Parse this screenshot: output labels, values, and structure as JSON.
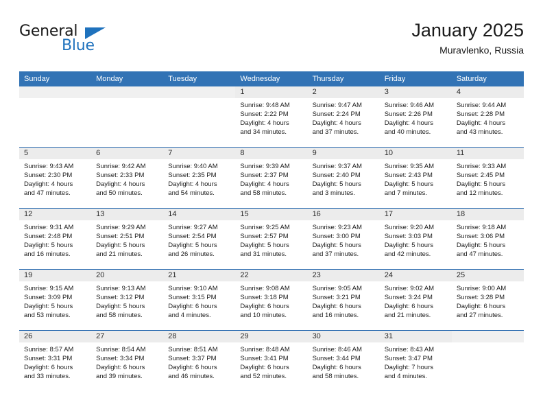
{
  "brand": {
    "name_top": "General",
    "name_bottom": "Blue",
    "triangle_icon": "triangle-icon",
    "color_blue": "#1f72bd",
    "color_black": "#1a1a1a"
  },
  "header": {
    "title": "January 2025",
    "subtitle": "Muravlenko, Russia"
  },
  "theme": {
    "header_bg": "#3273b5",
    "week_separator": "#2a6bb0",
    "daynum_bg": "#ececec",
    "cell_bg": "#ffffff"
  },
  "calendar": {
    "weekdays": [
      "Sunday",
      "Monday",
      "Tuesday",
      "Wednesday",
      "Thursday",
      "Friday",
      "Saturday"
    ],
    "labels": {
      "sunrise": "Sunrise:",
      "sunset": "Sunset:",
      "daylight": "Daylight:"
    },
    "weeks": [
      [
        {
          "day": "",
          "empty": true
        },
        {
          "day": "",
          "empty": true
        },
        {
          "day": "",
          "empty": true
        },
        {
          "day": "1",
          "sunrise": "Sunrise: 9:48 AM",
          "sunset": "Sunset: 2:22 PM",
          "daylight1": "Daylight: 4 hours",
          "daylight2": "and 34 minutes."
        },
        {
          "day": "2",
          "sunrise": "Sunrise: 9:47 AM",
          "sunset": "Sunset: 2:24 PM",
          "daylight1": "Daylight: 4 hours",
          "daylight2": "and 37 minutes."
        },
        {
          "day": "3",
          "sunrise": "Sunrise: 9:46 AM",
          "sunset": "Sunset: 2:26 PM",
          "daylight1": "Daylight: 4 hours",
          "daylight2": "and 40 minutes."
        },
        {
          "day": "4",
          "sunrise": "Sunrise: 9:44 AM",
          "sunset": "Sunset: 2:28 PM",
          "daylight1": "Daylight: 4 hours",
          "daylight2": "and 43 minutes."
        }
      ],
      [
        {
          "day": "5",
          "sunrise": "Sunrise: 9:43 AM",
          "sunset": "Sunset: 2:30 PM",
          "daylight1": "Daylight: 4 hours",
          "daylight2": "and 47 minutes."
        },
        {
          "day": "6",
          "sunrise": "Sunrise: 9:42 AM",
          "sunset": "Sunset: 2:33 PM",
          "daylight1": "Daylight: 4 hours",
          "daylight2": "and 50 minutes."
        },
        {
          "day": "7",
          "sunrise": "Sunrise: 9:40 AM",
          "sunset": "Sunset: 2:35 PM",
          "daylight1": "Daylight: 4 hours",
          "daylight2": "and 54 minutes."
        },
        {
          "day": "8",
          "sunrise": "Sunrise: 9:39 AM",
          "sunset": "Sunset: 2:37 PM",
          "daylight1": "Daylight: 4 hours",
          "daylight2": "and 58 minutes."
        },
        {
          "day": "9",
          "sunrise": "Sunrise: 9:37 AM",
          "sunset": "Sunset: 2:40 PM",
          "daylight1": "Daylight: 5 hours",
          "daylight2": "and 3 minutes."
        },
        {
          "day": "10",
          "sunrise": "Sunrise: 9:35 AM",
          "sunset": "Sunset: 2:43 PM",
          "daylight1": "Daylight: 5 hours",
          "daylight2": "and 7 minutes."
        },
        {
          "day": "11",
          "sunrise": "Sunrise: 9:33 AM",
          "sunset": "Sunset: 2:45 PM",
          "daylight1": "Daylight: 5 hours",
          "daylight2": "and 12 minutes."
        }
      ],
      [
        {
          "day": "12",
          "sunrise": "Sunrise: 9:31 AM",
          "sunset": "Sunset: 2:48 PM",
          "daylight1": "Daylight: 5 hours",
          "daylight2": "and 16 minutes."
        },
        {
          "day": "13",
          "sunrise": "Sunrise: 9:29 AM",
          "sunset": "Sunset: 2:51 PM",
          "daylight1": "Daylight: 5 hours",
          "daylight2": "and 21 minutes."
        },
        {
          "day": "14",
          "sunrise": "Sunrise: 9:27 AM",
          "sunset": "Sunset: 2:54 PM",
          "daylight1": "Daylight: 5 hours",
          "daylight2": "and 26 minutes."
        },
        {
          "day": "15",
          "sunrise": "Sunrise: 9:25 AM",
          "sunset": "Sunset: 2:57 PM",
          "daylight1": "Daylight: 5 hours",
          "daylight2": "and 31 minutes."
        },
        {
          "day": "16",
          "sunrise": "Sunrise: 9:23 AM",
          "sunset": "Sunset: 3:00 PM",
          "daylight1": "Daylight: 5 hours",
          "daylight2": "and 37 minutes."
        },
        {
          "day": "17",
          "sunrise": "Sunrise: 9:20 AM",
          "sunset": "Sunset: 3:03 PM",
          "daylight1": "Daylight: 5 hours",
          "daylight2": "and 42 minutes."
        },
        {
          "day": "18",
          "sunrise": "Sunrise: 9:18 AM",
          "sunset": "Sunset: 3:06 PM",
          "daylight1": "Daylight: 5 hours",
          "daylight2": "and 47 minutes."
        }
      ],
      [
        {
          "day": "19",
          "sunrise": "Sunrise: 9:15 AM",
          "sunset": "Sunset: 3:09 PM",
          "daylight1": "Daylight: 5 hours",
          "daylight2": "and 53 minutes."
        },
        {
          "day": "20",
          "sunrise": "Sunrise: 9:13 AM",
          "sunset": "Sunset: 3:12 PM",
          "daylight1": "Daylight: 5 hours",
          "daylight2": "and 58 minutes."
        },
        {
          "day": "21",
          "sunrise": "Sunrise: 9:10 AM",
          "sunset": "Sunset: 3:15 PM",
          "daylight1": "Daylight: 6 hours",
          "daylight2": "and 4 minutes."
        },
        {
          "day": "22",
          "sunrise": "Sunrise: 9:08 AM",
          "sunset": "Sunset: 3:18 PM",
          "daylight1": "Daylight: 6 hours",
          "daylight2": "and 10 minutes."
        },
        {
          "day": "23",
          "sunrise": "Sunrise: 9:05 AM",
          "sunset": "Sunset: 3:21 PM",
          "daylight1": "Daylight: 6 hours",
          "daylight2": "and 16 minutes."
        },
        {
          "day": "24",
          "sunrise": "Sunrise: 9:02 AM",
          "sunset": "Sunset: 3:24 PM",
          "daylight1": "Daylight: 6 hours",
          "daylight2": "and 21 minutes."
        },
        {
          "day": "25",
          "sunrise": "Sunrise: 9:00 AM",
          "sunset": "Sunset: 3:28 PM",
          "daylight1": "Daylight: 6 hours",
          "daylight2": "and 27 minutes."
        }
      ],
      [
        {
          "day": "26",
          "sunrise": "Sunrise: 8:57 AM",
          "sunset": "Sunset: 3:31 PM",
          "daylight1": "Daylight: 6 hours",
          "daylight2": "and 33 minutes."
        },
        {
          "day": "27",
          "sunrise": "Sunrise: 8:54 AM",
          "sunset": "Sunset: 3:34 PM",
          "daylight1": "Daylight: 6 hours",
          "daylight2": "and 39 minutes."
        },
        {
          "day": "28",
          "sunrise": "Sunrise: 8:51 AM",
          "sunset": "Sunset: 3:37 PM",
          "daylight1": "Daylight: 6 hours",
          "daylight2": "and 46 minutes."
        },
        {
          "day": "29",
          "sunrise": "Sunrise: 8:48 AM",
          "sunset": "Sunset: 3:41 PM",
          "daylight1": "Daylight: 6 hours",
          "daylight2": "and 52 minutes."
        },
        {
          "day": "30",
          "sunrise": "Sunrise: 8:46 AM",
          "sunset": "Sunset: 3:44 PM",
          "daylight1": "Daylight: 6 hours",
          "daylight2": "and 58 minutes."
        },
        {
          "day": "31",
          "sunrise": "Sunrise: 8:43 AM",
          "sunset": "Sunset: 3:47 PM",
          "daylight1": "Daylight: 7 hours",
          "daylight2": "and 4 minutes."
        },
        {
          "day": "",
          "empty": true
        }
      ]
    ]
  }
}
